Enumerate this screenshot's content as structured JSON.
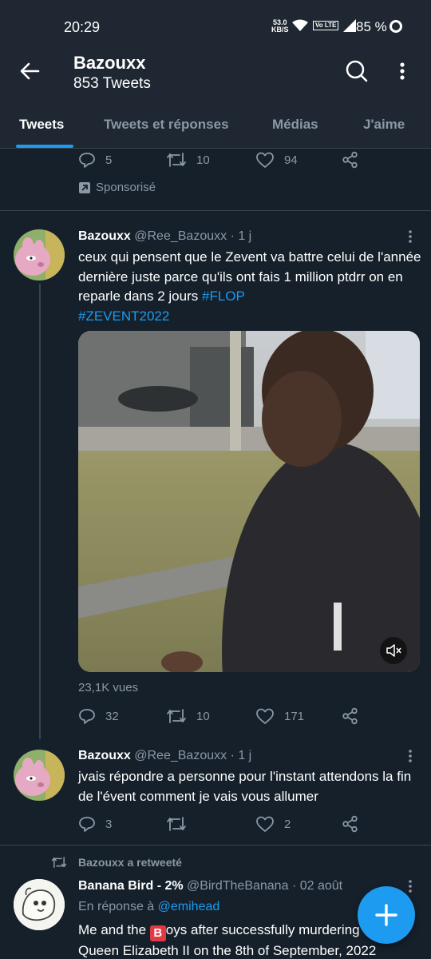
{
  "status_bar": {
    "time": "20:29",
    "net_speed_value": "53.0",
    "net_speed_unit": "KB/S",
    "volte": "Vo LTE",
    "battery": "85 %"
  },
  "header": {
    "title": "Bazouxx",
    "subtitle": "853 Tweets"
  },
  "tabs": [
    {
      "label": "Tweets",
      "active": true
    },
    {
      "label": "Tweets et réponses",
      "active": false
    },
    {
      "label": "Médias",
      "active": false
    },
    {
      "label": "J'aime",
      "active": false
    }
  ],
  "tweet_prev": {
    "replies": "5",
    "retweets": "10",
    "likes": "94",
    "promoted_label": "Sponsorisé"
  },
  "tweet1": {
    "name": "Bazouxx",
    "handle": "@Ree_Bazouxx",
    "time": "· 1 j",
    "text": "ceux qui pensent que le Zevent va battre celui de l'année dernière juste parce qu'ils ont fais 1 million ptdrr on en reparle dans 2 jours ",
    "hashtags": [
      "#FLOP",
      "#ZEVENT2022"
    ],
    "views": "23,1K vues",
    "replies": "32",
    "retweets": "10",
    "likes": "171"
  },
  "tweet2": {
    "name": "Bazouxx",
    "handle": "@Ree_Bazouxx",
    "time": "· 1 j",
    "text": "jvais répondre a personne pour l'instant attendons la fin de l'évent comment je vais vous allumer",
    "replies": "3",
    "retweets": "",
    "likes": "2"
  },
  "tweet3": {
    "retweet_label": "Bazouxx a retweeté",
    "name": "Banana Bird - 2%",
    "handle": "@BirdTheBanana",
    "time": "· 02 août",
    "reply_prefix": "En réponse à",
    "reply_to": "@emihead",
    "text_line1_a": "Me and the",
    "text_line1_b": "oys after successfully murdering",
    "text_line2": "Queen Elizabeth II on the 8th of September, 2022"
  },
  "colors": {
    "background": "#15202b",
    "header": "#1e2732",
    "accent": "#1d9bf0",
    "muted": "#8b98a5",
    "divider": "#38444d"
  }
}
